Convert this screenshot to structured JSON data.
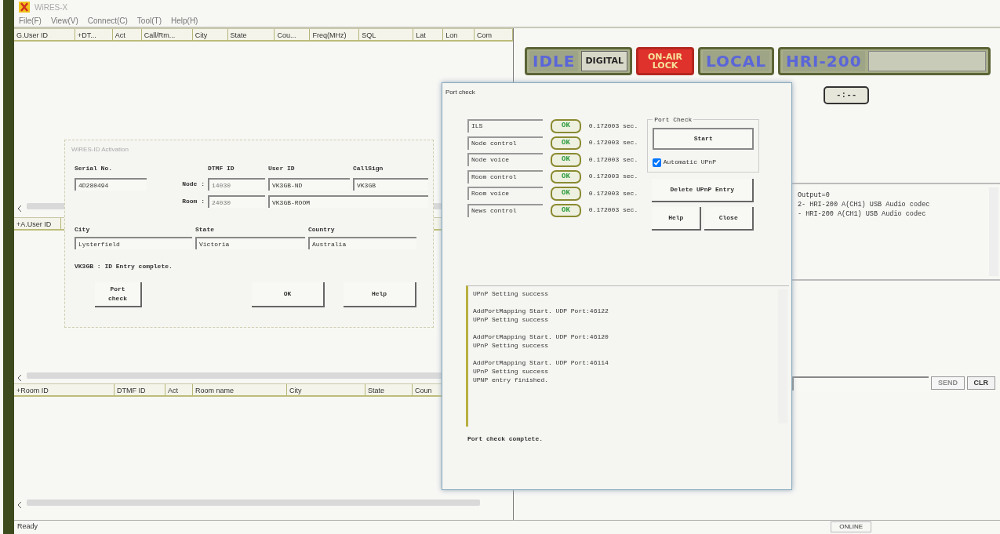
{
  "window": {
    "title": "WiRES-X"
  },
  "menu": [
    "File(F)",
    "View(V)",
    "Connect(C)",
    "Tool(T)",
    "Help(H)"
  ],
  "user_table": {
    "columns": [
      "G.User ID",
      "+DT...",
      "Act",
      "Call/Rm...",
      "City",
      "State",
      "Cou...",
      "Freq(MHz)",
      "SQL",
      "Lat",
      "Lon",
      "Com"
    ]
  },
  "active_user_table": {
    "columns": [
      "+A.User ID"
    ]
  },
  "room_table": {
    "columns": [
      "+Room ID",
      "DTMF ID",
      "Act",
      "Room name",
      "City",
      "State",
      "Coun"
    ]
  },
  "indicator_panels": [
    {
      "kind": "frame",
      "items": [
        {
          "kind": "glow",
          "text": "IDLE"
        },
        {
          "kind": "plain",
          "text": "DIGITAL"
        }
      ]
    },
    {
      "kind": "alert",
      "items": [
        {
          "kind": "alert",
          "text": "ON-AIR LOCK"
        }
      ]
    },
    {
      "kind": "frame",
      "items": [
        {
          "kind": "glow",
          "text": "LOCAL"
        }
      ]
    },
    {
      "kind": "frame",
      "items": [
        {
          "kind": "glow",
          "text": "HRI-200"
        },
        {
          "kind": "empty"
        }
      ]
    }
  ],
  "timer": "-:--",
  "log_lines": [
    "Output=0",
    "2- HRI-200 A(CH1) USB Audio codec",
    "- HRI-200 A(CH1) USB Audio codec"
  ],
  "send_button": {
    "label": "SEND",
    "disabled": true
  },
  "clear_button": {
    "label": "CLR"
  },
  "status_bar": {
    "text": "Ready",
    "indicator": "ONLINE"
  },
  "activation_dialog": {
    "title": "WiRES-ID Activation",
    "serial_label": "Serial No.",
    "serial": "4D280494",
    "column_labels": [
      "DTMF ID",
      "User ID",
      "CallSign"
    ],
    "rows": [
      {
        "label": "Node :",
        "dtmf": {
          "value": "14030",
          "disabled": true
        },
        "user_id": "VK3GB-ND",
        "callsign": "VK3GB"
      },
      {
        "label": "Room :",
        "dtmf": {
          "value": "24030",
          "disabled": true
        },
        "user_id": "VK3GB-ROOM"
      }
    ],
    "location": [
      {
        "label": "City",
        "value": "Lysterfield"
      },
      {
        "label": "State",
        "value": "Victoria"
      },
      {
        "label": "Country",
        "value": "Australia"
      }
    ],
    "message": "VK3GB : ID Entry complete.",
    "buttons": [
      "Port check",
      "OK",
      "Help"
    ]
  },
  "port_check_dialog": {
    "title": "Port check",
    "ports": [
      {
        "name": "ILS",
        "result": "OK",
        "time": "0.172003 sec."
      },
      {
        "name": "Node control",
        "result": "OK",
        "time": "0.172003 sec."
      },
      {
        "name": "Node voice",
        "result": "OK",
        "time": "0.172003 sec."
      },
      {
        "name": "Room control",
        "result": "OK",
        "time": "0.172003 sec."
      },
      {
        "name": "Room voice",
        "result": "OK",
        "time": "0.172003 sec."
      },
      {
        "name": "News control",
        "result": "OK",
        "time": "0.172003 sec."
      }
    ],
    "group_title": "Port Check",
    "start_button": "Start",
    "auto_upnp": {
      "label": "Automatic UPnP",
      "checked": true
    },
    "buttons": [
      "Delete UPnP Entry",
      "Help",
      "Close"
    ],
    "log": [
      [
        "UPnP Setting success"
      ],
      [
        "AddPortMapping Start. UDP Port:46122",
        "UPnP Setting success"
      ],
      [
        "AddPortMapping Start. UDP Port:46120",
        "UPnP Setting success"
      ],
      [
        "AddPortMapping Start. UDP Port:46114",
        "UPnP Setting success",
        "UPNP entry finished."
      ]
    ],
    "status": "Port check complete."
  }
}
